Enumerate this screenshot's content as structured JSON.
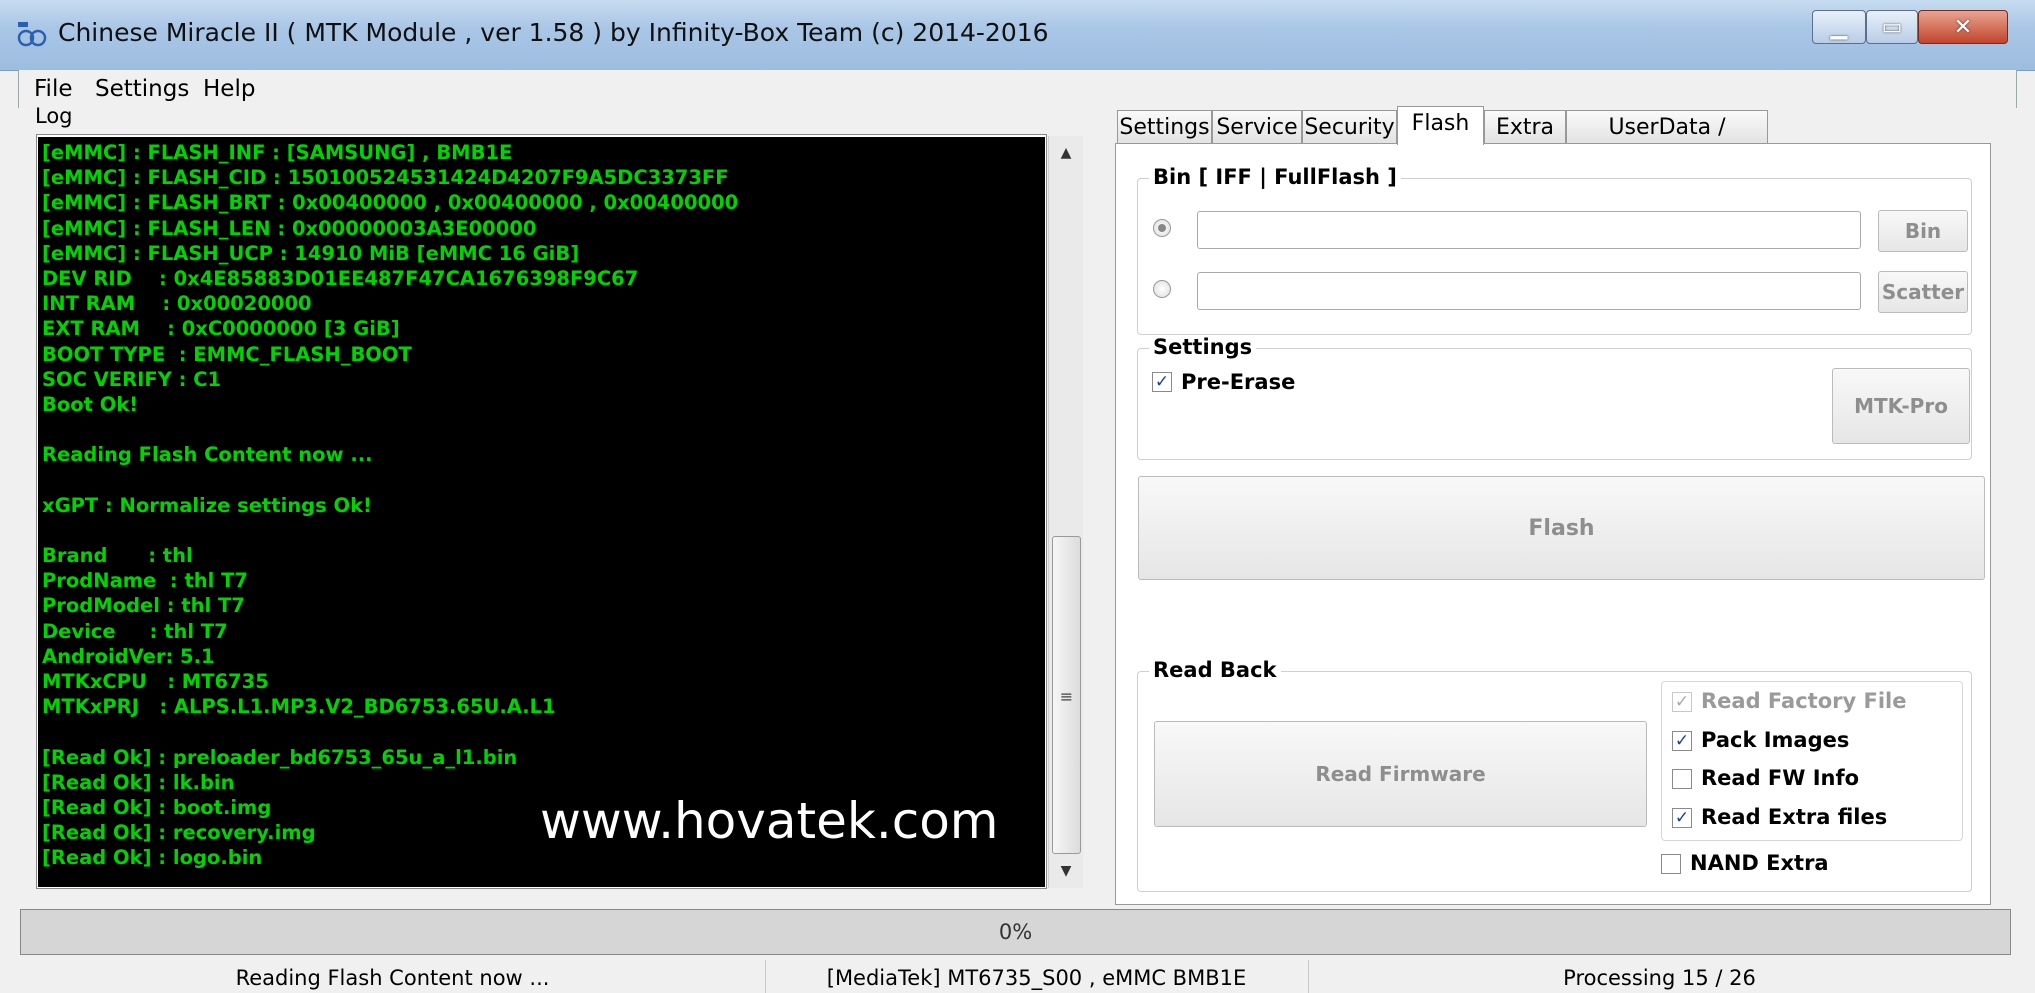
{
  "window": {
    "title": "Chinese Miracle II ( MTK Module , ver 1.58 ) by Infinity-Box Team (c) 2014-2016"
  },
  "menu": [
    "File",
    "Settings",
    "Help"
  ],
  "log": {
    "label": "Log",
    "lines": [
      "[eMMC] : FLASH_INF : [SAMSUNG] , BMB1E",
      "[eMMC] : FLASH_CID : 150100524531424D4207F9A5DC3373FF",
      "[eMMC] : FLASH_BRT : 0x00400000 , 0x00400000 , 0x00400000",
      "[eMMC] : FLASH_LEN : 0x00000003A3E00000",
      "[eMMC] : FLASH_UCP : 14910 MiB [eMMC 16 GiB]",
      "DEV RID    : 0x4E85883D01EE487F47CA1676398F9C67",
      "INT RAM    : 0x00020000",
      "EXT RAM    : 0xC0000000 [3 GiB]",
      "BOOT TYPE  : EMMC_FLASH_BOOT",
      "SOC VERIFY : C1",
      "Boot Ok!",
      "",
      "Reading Flash Content now ...",
      "",
      "xGPT : Normalize settings Ok!",
      "",
      "Brand      : thl",
      "ProdName  : thl T7",
      "ProdModel : thl T7",
      "Device     : thl T7",
      "AndroidVer: 5.1",
      "MTKxCPU   : MT6735",
      "MTKxPRJ   : ALPS.L1.MP3.V2_BD6753.65U.A.L1",
      "",
      "[Read Ok] : preloader_bd6753_65u_a_l1.bin",
      "[Read Ok] : lk.bin",
      "[Read Ok] : boot.img",
      "[Read Ok] : recovery.img",
      "[Read Ok] : logo.bin"
    ]
  },
  "watermark": "www.hovatek.com",
  "tabs": [
    "Settings",
    "Service",
    "Security",
    "Flash",
    "Extra",
    "UserData / Forensic"
  ],
  "active_tab": "Flash",
  "flash_panel": {
    "bin_group_title": "Bin  [ IFF | FullFlash ]",
    "bin_button": "Bin",
    "scatter_button": "Scatter",
    "settings_group_title": "Settings",
    "pre_erase_label": "Pre-Erase",
    "pre_erase_checked": true,
    "mtk_pro_button": "MTK-Pro",
    "flash_button": "Flash",
    "read_back_title": "Read Back",
    "read_firmware_button": "Read Firmware",
    "options": [
      {
        "label": "Read Factory File",
        "checked": true,
        "disabled": true
      },
      {
        "label": "Pack Images",
        "checked": true,
        "disabled": false
      },
      {
        "label": "Read FW Info",
        "checked": false,
        "disabled": false
      },
      {
        "label": "Read Extra files",
        "checked": true,
        "disabled": false
      }
    ],
    "nand_extra_label": "NAND Extra",
    "nand_extra_checked": false
  },
  "progress": {
    "text": "0%",
    "value": 0
  },
  "status": {
    "left": "Reading Flash Content now ...",
    "middle": "[MediaTek] MT6735_S00 , eMMC BMB1E",
    "right": "Processing 15 / 26"
  },
  "colors": {
    "log_bg": "#000000",
    "log_text": "#00d400",
    "progress_fill": "#3a9a3a"
  }
}
